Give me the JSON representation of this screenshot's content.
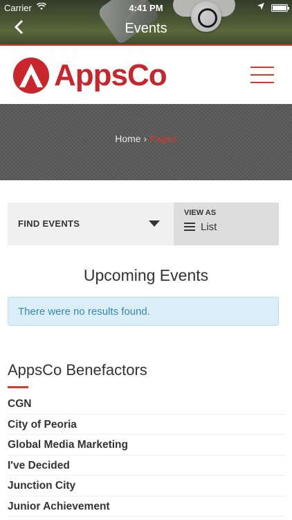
{
  "status_bar": {
    "carrier": "Carrier",
    "time": "4:41 PM"
  },
  "nav": {
    "title": "Events",
    "back_icon": "chevron-left-icon"
  },
  "brand": {
    "name": "AppsCo",
    "color": "#c8262c"
  },
  "breadcrumb": {
    "home": "Home",
    "separator": "›",
    "current": "Pages"
  },
  "filter": {
    "find_label": "FIND EVENTS",
    "view_as_label": "VIEW AS",
    "view_mode": "List"
  },
  "events": {
    "heading": "Upcoming Events",
    "empty_message": "There were no results found."
  },
  "benefactors": {
    "heading": "AppsCo Benefactors",
    "items": [
      "CGN",
      "City of Peoria",
      "Global Media Marketing",
      "I've Decided",
      "Junction City",
      "Junior Achievement"
    ]
  },
  "colors": {
    "accent": "#d8392b",
    "alert_bg": "#d9eef7",
    "alert_text": "#3a87ad"
  }
}
